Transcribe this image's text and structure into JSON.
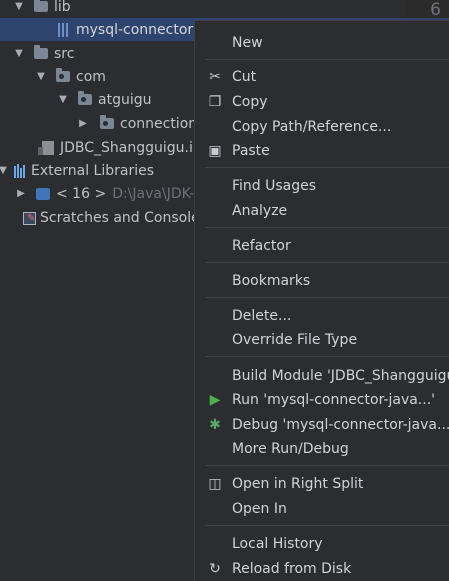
{
  "editor": {
    "line_number": "6"
  },
  "tree": {
    "lib": "lib",
    "jar": "mysql-connector",
    "src": "src",
    "com": "com",
    "atguigu": "atguigu",
    "connection": "connectior",
    "iml": "JDBC_Shangguigu.ir",
    "ext_libs": "External Libraries",
    "jdk": "< 16 >",
    "jdk_path": "D:\\Java\\JDK-",
    "scratches": "Scratches and Consoles"
  },
  "menu": {
    "new": "New",
    "cut": "Cut",
    "copy": "Copy",
    "copy_path": "Copy Path/Reference...",
    "paste": "Paste",
    "find_usages": "Find Usages",
    "analyze": "Analyze",
    "refactor": "Refactor",
    "bookmarks": "Bookmarks",
    "delete": "Delete...",
    "override": "Override File Type",
    "build_module": "Build Module 'JDBC_Shangguigu",
    "run": "Run 'mysql-connector-java...'",
    "debug": "Debug 'mysql-connector-java...'",
    "more_run": "More Run/Debug",
    "open_split": "Open in Right Split",
    "open_in": "Open In",
    "local_history": "Local History",
    "reload": "Reload from Disk"
  },
  "colors": {
    "selection": "#2e436e",
    "run_icon": "#4caf50",
    "debug_icon": "#59a869",
    "folder": "#7b8794"
  }
}
